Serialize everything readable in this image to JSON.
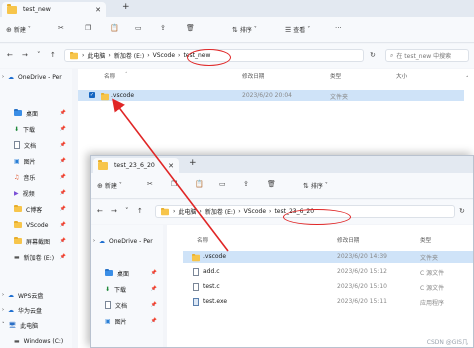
{
  "window_back": {
    "tab_title": "test_new",
    "toolbar": {
      "new_label": "新建",
      "sort_label": "排序",
      "view_label": "查看"
    },
    "breadcrumb": [
      "此电脑",
      "新加卷 (E:)",
      "VScode",
      "test_new"
    ],
    "search_placeholder": "在 test_new 中搜索",
    "columns": {
      "name": "名称",
      "date": "修改日期",
      "type": "类型",
      "size": "大小"
    },
    "files": [
      {
        "name": ".vscode",
        "date": "2023/6/20 20:04",
        "type": "文件夹"
      }
    ],
    "sidebar": [
      {
        "label": "OneDrive - Per",
        "icon": "cloud-icon"
      },
      {
        "label": "桌面",
        "icon": "desktop-icon"
      },
      {
        "label": "下载",
        "icon": "download-icon"
      },
      {
        "label": "文档",
        "icon": "document-icon"
      },
      {
        "label": "图片",
        "icon": "pictures-icon"
      },
      {
        "label": "音乐",
        "icon": "music-icon"
      },
      {
        "label": "视频",
        "icon": "video-icon"
      },
      {
        "label": "C博客",
        "icon": "folder-icon"
      },
      {
        "label": "VScode",
        "icon": "folder-icon"
      },
      {
        "label": "屏幕截图",
        "icon": "folder-icon"
      },
      {
        "label": "新加卷 (E:)",
        "icon": "drive-icon"
      },
      {
        "label": "WPS云盘",
        "icon": "cloud-icon"
      },
      {
        "label": "华为云盘",
        "icon": "cloud-icon"
      },
      {
        "label": "此电脑",
        "icon": "pc-icon"
      },
      {
        "label": "Windows (C:)",
        "icon": "drive-icon"
      }
    ]
  },
  "window_front": {
    "tab_title": "test_23_6_20",
    "toolbar": {
      "new_label": "新建",
      "sort_label": "排序"
    },
    "breadcrumb": [
      "此电脑",
      "新加卷 (E:)",
      "VScode",
      "test_23_6_20"
    ],
    "columns": {
      "name": "名称",
      "date": "修改日期",
      "type": "类型"
    },
    "files": [
      {
        "name": ".vscode",
        "date": "2023/6/20 14:39",
        "type": "文件夹",
        "icon": "folder"
      },
      {
        "name": "add.c",
        "date": "2023/6/20 15:12",
        "type": "C 源文件",
        "icon": "c-file"
      },
      {
        "name": "test.c",
        "date": "2023/6/20 15:10",
        "type": "C 源文件",
        "icon": "c-file"
      },
      {
        "name": "test.exe",
        "date": "2023/6/20 15:11",
        "type": "应用程序",
        "icon": "exe"
      }
    ],
    "sidebar": [
      {
        "label": "OneDrive - Per",
        "icon": "cloud-icon"
      },
      {
        "label": "桌面",
        "icon": "desktop-icon"
      },
      {
        "label": "下载",
        "icon": "download-icon"
      },
      {
        "label": "文档",
        "icon": "document-icon"
      },
      {
        "label": "图片",
        "icon": "pictures-icon"
      }
    ]
  },
  "watermark": "CSDN @GIS几",
  "colors": {
    "annotation_red": "#e02626",
    "selection": "#cfe3f8",
    "folder": "#f7c54b",
    "accent": "#1565c0"
  }
}
